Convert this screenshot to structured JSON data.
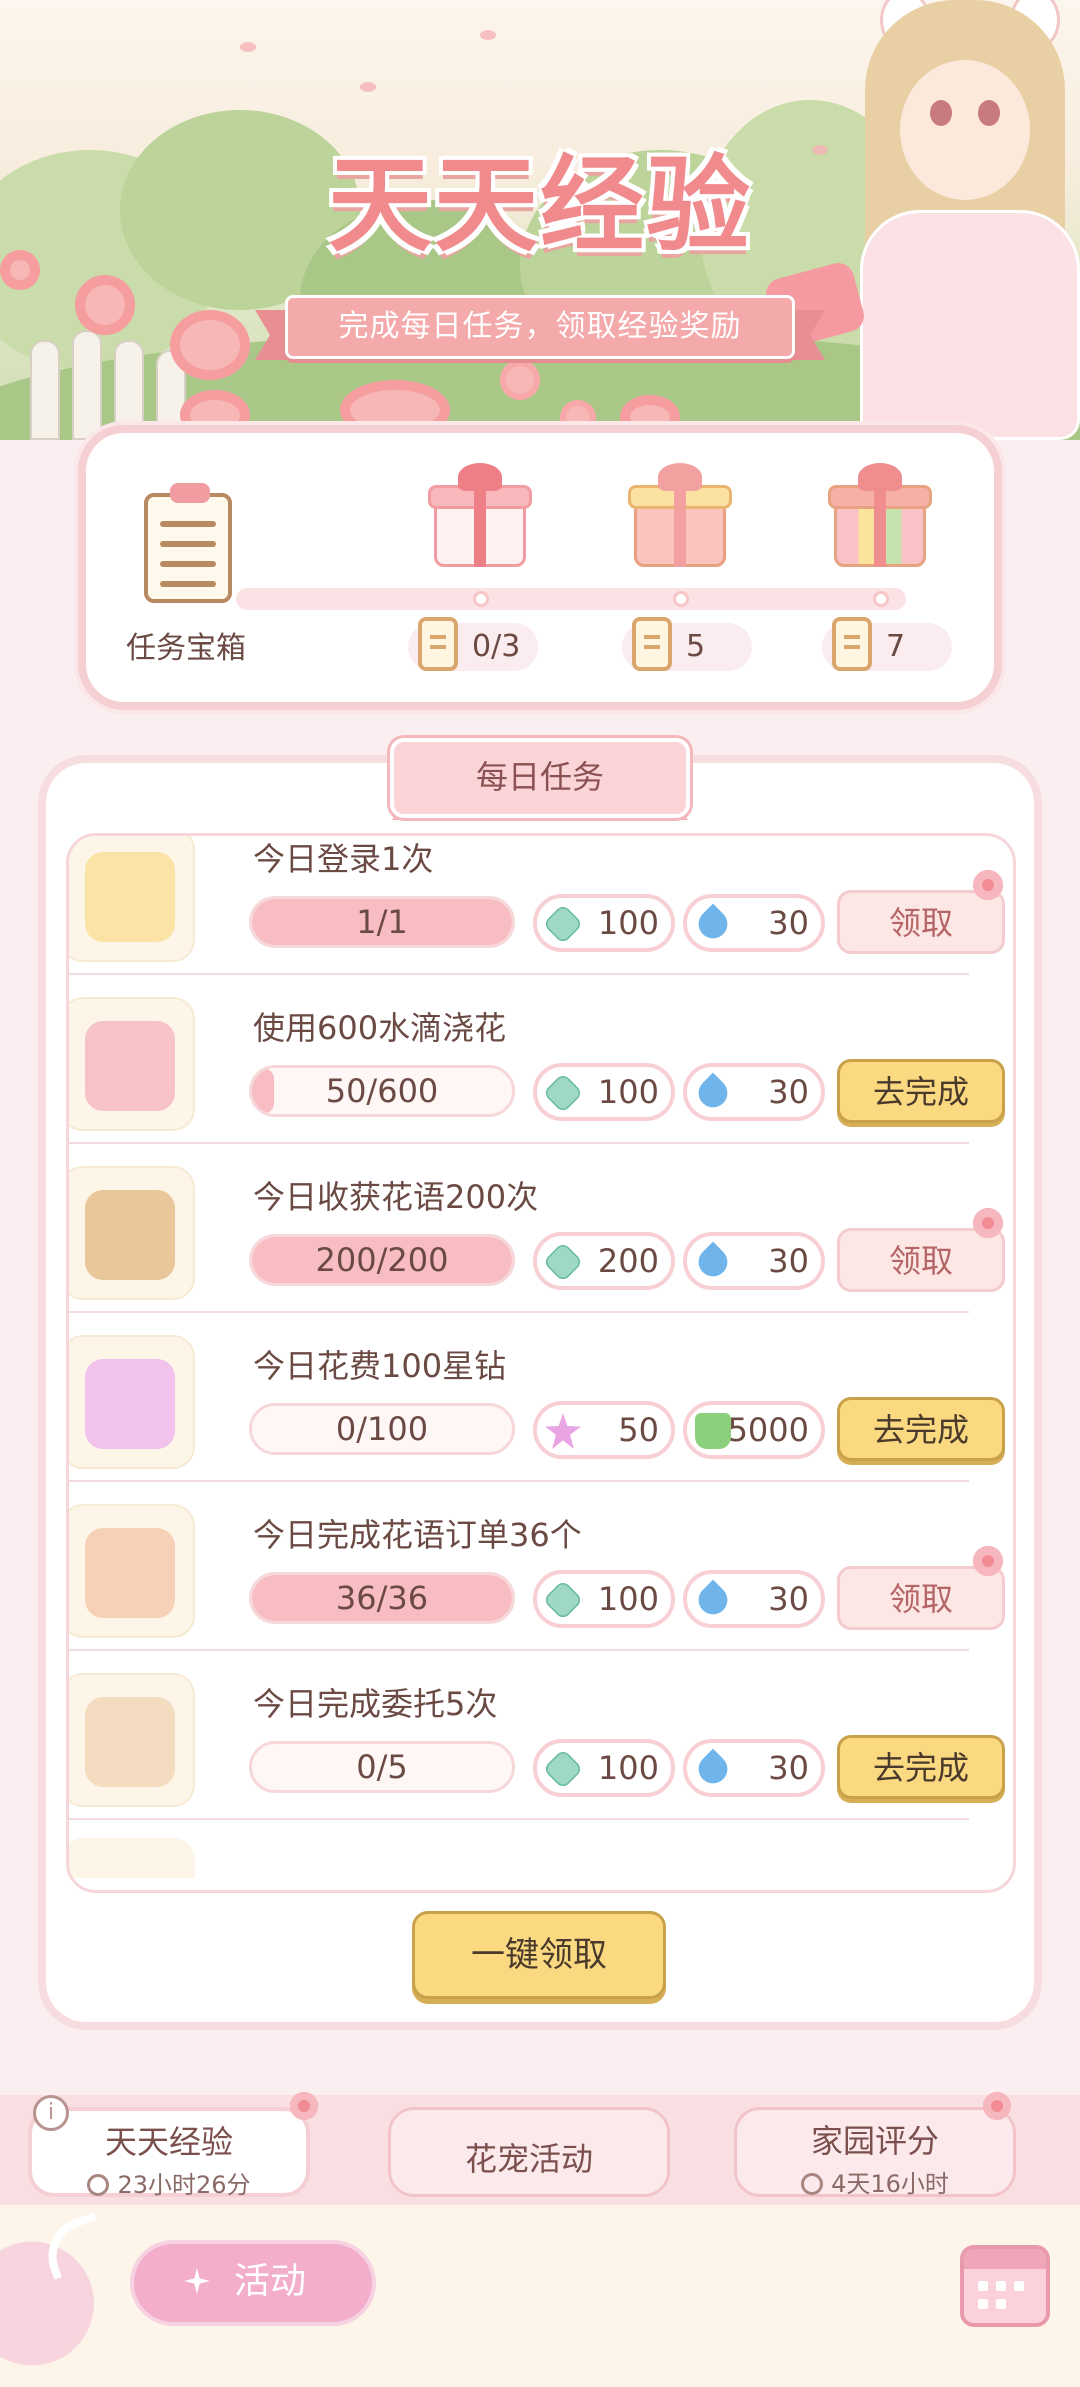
{
  "hero": {
    "title": "天天经验",
    "subtitle": "完成每日任务，领取经验奖励"
  },
  "chest": {
    "label": "任务宝箱",
    "milestones": [
      {
        "count": "0/3",
        "icon": "gift-box-pink-icon"
      },
      {
        "count": "5",
        "icon": "gift-box-gold-icon"
      },
      {
        "count": "7",
        "icon": "gift-box-rainbow-icon"
      }
    ],
    "progress": 0
  },
  "daily_tasks": {
    "header": "每日任务",
    "tasks": [
      {
        "title": "今日登录1次",
        "progress_text": "1/1",
        "progress": 1.0,
        "icon": "login-gamepad-icon",
        "rewards": [
          {
            "icon": "exp-icon",
            "value": "100"
          },
          {
            "icon": "water-drop-icon",
            "value": "30"
          }
        ],
        "action": "领取",
        "action_type": "claim"
      },
      {
        "title": "使用600水滴浇花",
        "progress_text": "50/600",
        "progress": 0.083,
        "icon": "watering-can-icon",
        "rewards": [
          {
            "icon": "exp-icon",
            "value": "100"
          },
          {
            "icon": "water-drop-icon",
            "value": "30"
          }
        ],
        "action": "去完成",
        "action_type": "go"
      },
      {
        "title": "今日收获花语200次",
        "progress_text": "200/200",
        "progress": 1.0,
        "icon": "flower-basket-icon",
        "rewards": [
          {
            "icon": "exp-icon",
            "value": "200"
          },
          {
            "icon": "water-drop-icon",
            "value": "30"
          }
        ],
        "action": "领取",
        "action_type": "claim"
      },
      {
        "title": "今日花费100星钻",
        "progress_text": "0/100",
        "progress": 0,
        "icon": "star-diamond-icon",
        "rewards": [
          {
            "icon": "star-diamond-icon",
            "value": "50"
          },
          {
            "icon": "fertilizer-bottle-icon",
            "value": "5000"
          }
        ],
        "action": "去完成",
        "action_type": "go"
      },
      {
        "title": "今日完成花语订单36个",
        "progress_text": "36/36",
        "progress": 1.0,
        "icon": "bouquet-order-icon",
        "rewards": [
          {
            "icon": "exp-icon",
            "value": "100"
          },
          {
            "icon": "water-drop-icon",
            "value": "30"
          }
        ],
        "action": "领取",
        "action_type": "claim"
      },
      {
        "title": "今日完成委托5次",
        "progress_text": "0/5",
        "progress": 0,
        "icon": "commission-clipboard-icon",
        "rewards": [
          {
            "icon": "exp-icon",
            "value": "100"
          },
          {
            "icon": "water-drop-icon",
            "value": "30"
          }
        ],
        "action": "去完成",
        "action_type": "go"
      }
    ],
    "claim_all": "一键领取"
  },
  "bottom_tabs": [
    {
      "name": "天天经验",
      "timer": "23小时26分",
      "active": true
    },
    {
      "name": "花宠活动",
      "timer": "",
      "active": false
    },
    {
      "name": "家园评分",
      "timer": "4天16小时",
      "active": false
    }
  ],
  "info_icon": "i",
  "footer": {
    "activity": "活动"
  },
  "colors": {
    "accent_pink": "#f08a8c",
    "claim_button": "#fce7e5",
    "go_button": "#fbd980",
    "panel_border": "#f6cfd3"
  }
}
